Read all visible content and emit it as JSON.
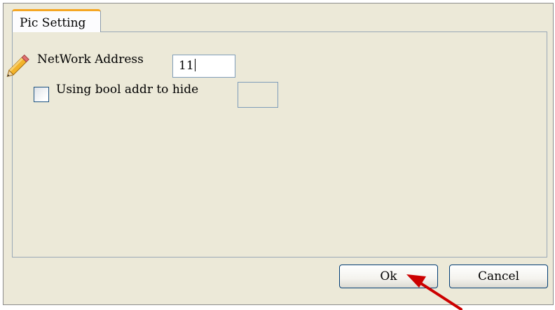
{
  "dialog": {
    "tab_label": "Pic Setting",
    "network_address_label": "NetWork Address",
    "network_address_value": "11",
    "bool_hide_label": "Using bool addr to hide",
    "bool_hide_checked": false,
    "bool_addr_value": "",
    "ok_label": "Ok",
    "cancel_label": "Cancel"
  },
  "icons": {
    "pencil": "pencil-icon",
    "annotation_arrow": "red-arrow"
  },
  "colors": {
    "dialog_bg": "#ece9d8",
    "tab_accent": "#f5a623",
    "arrow": "#cc0000"
  }
}
